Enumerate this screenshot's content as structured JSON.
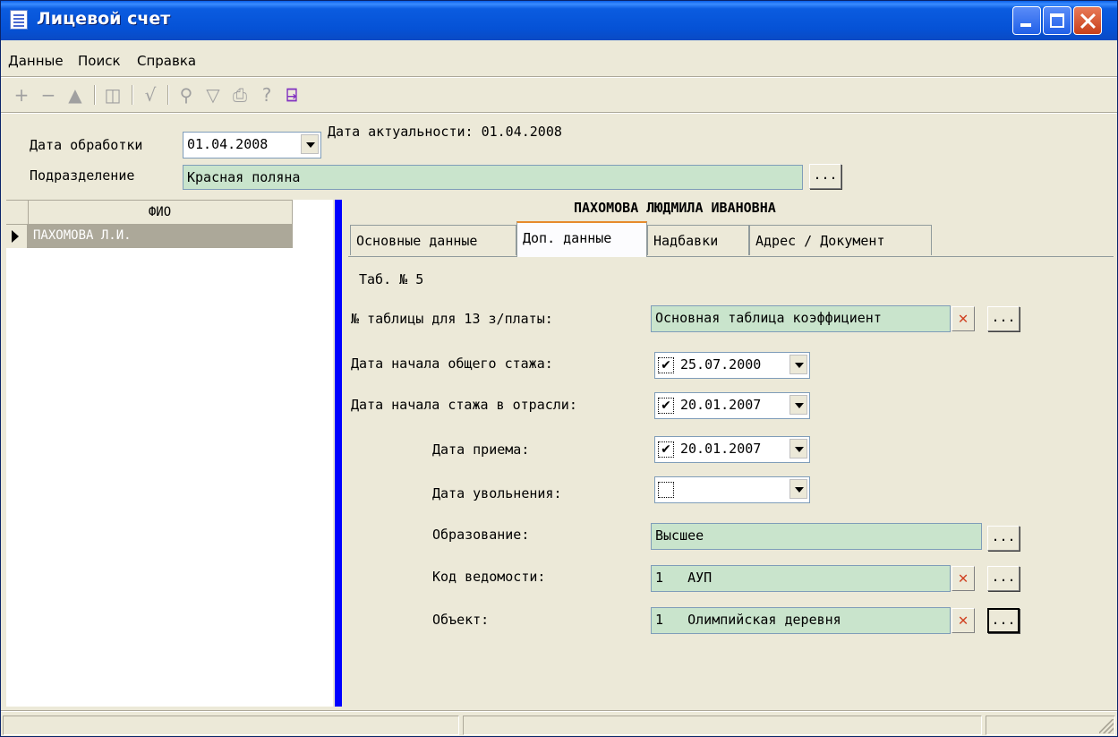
{
  "window": {
    "title": "Лицевой счет",
    "min_icon": "minimize-icon",
    "max_icon": "maximize-icon",
    "close_icon": "close-icon"
  },
  "menu": [
    "Данные",
    "Поиск",
    "Справка"
  ],
  "toolbar": {
    "icons": [
      "plus-icon",
      "minus-icon",
      "up-icon",
      "book-icon",
      "check-icon",
      "binoculars-icon",
      "filter-icon",
      "printer-icon",
      "help-icon",
      "exit-icon"
    ],
    "glyphs": [
      "+",
      "−",
      "▲",
      "◫",
      "√",
      "⚲",
      "▽",
      "⎙",
      "?",
      "⍈"
    ]
  },
  "header": {
    "date_label": "Дата обработки",
    "date_value": "01.04.2008",
    "actual_date_text": "Дата актуальности: 01.04.2008",
    "division_label": "Подразделение",
    "division_value": "Красная поляна",
    "ellipsis": "..."
  },
  "grid": {
    "column": "ФИО",
    "rows": [
      "ПАХОМОВА Л.И."
    ]
  },
  "person_name": "ПАХОМОВА ЛЮДМИЛА ИВАНОВНА",
  "tabs": [
    "Основные данные",
    "Доп. данные",
    "Надбавки",
    "Адрес / Документ"
  ],
  "active_tab": "Доп. данные",
  "form": {
    "tab_number": "Таб. № 5",
    "table13_label": "№ таблицы для 13 з/платы:",
    "table13_value": "Основная таблица коэффициент",
    "total_exp_label": "Дата начала общего стажа:",
    "total_exp_value": "25.07.2000",
    "industry_exp_label": "Дата начала стажа в отрасли:",
    "industry_exp_value": "20.01.2007",
    "hire_label": "Дата приема:",
    "hire_value": "20.01.2007",
    "dismiss_label": "Дата увольнения:",
    "dismiss_value": "",
    "education_label": "Образование:",
    "education_value": "Высшее",
    "statement_label": "Код ведомости:",
    "statement_value": "1   АУП",
    "object_label": "Объект:",
    "object_value": "1   Олимпийская деревня",
    "check_mark": "✔"
  }
}
